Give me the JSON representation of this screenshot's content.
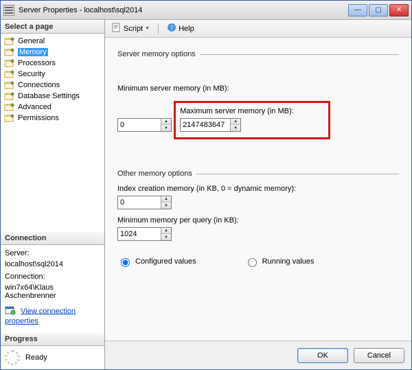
{
  "window": {
    "title": "Server Properties - localhost\\sql2014"
  },
  "left": {
    "select_page": "Select a page",
    "pages": [
      {
        "label": "General"
      },
      {
        "label": "Memory",
        "selected": true
      },
      {
        "label": "Processors"
      },
      {
        "label": "Security"
      },
      {
        "label": "Connections"
      },
      {
        "label": "Database Settings"
      },
      {
        "label": "Advanced"
      },
      {
        "label": "Permissions"
      }
    ],
    "connection_header": "Connection",
    "server_label": "Server:",
    "server_value": "localhost\\sql2014",
    "connection_label": "Connection:",
    "connection_value": "win7x64\\Klaus Aschenbrenner",
    "view_conn_props": "View connection properties",
    "progress_header": "Progress",
    "progress_status": "Ready"
  },
  "toolbar": {
    "script": "Script",
    "help": "Help"
  },
  "content": {
    "server_memory_options": "Server memory options",
    "min_label": "Minimum server memory (in MB):",
    "min_value": "0",
    "max_label": "Maximum server memory (in MB):",
    "max_value": "2147483647",
    "other_memory_options": "Other memory options",
    "index_label": "Index creation memory (in KB, 0 = dynamic memory):",
    "index_value": "0",
    "minq_label": "Minimum memory per query (in KB):",
    "minq_value": "1024",
    "configured": "Configured values",
    "running": "Running values"
  },
  "footer": {
    "ok": "OK",
    "cancel": "Cancel"
  }
}
